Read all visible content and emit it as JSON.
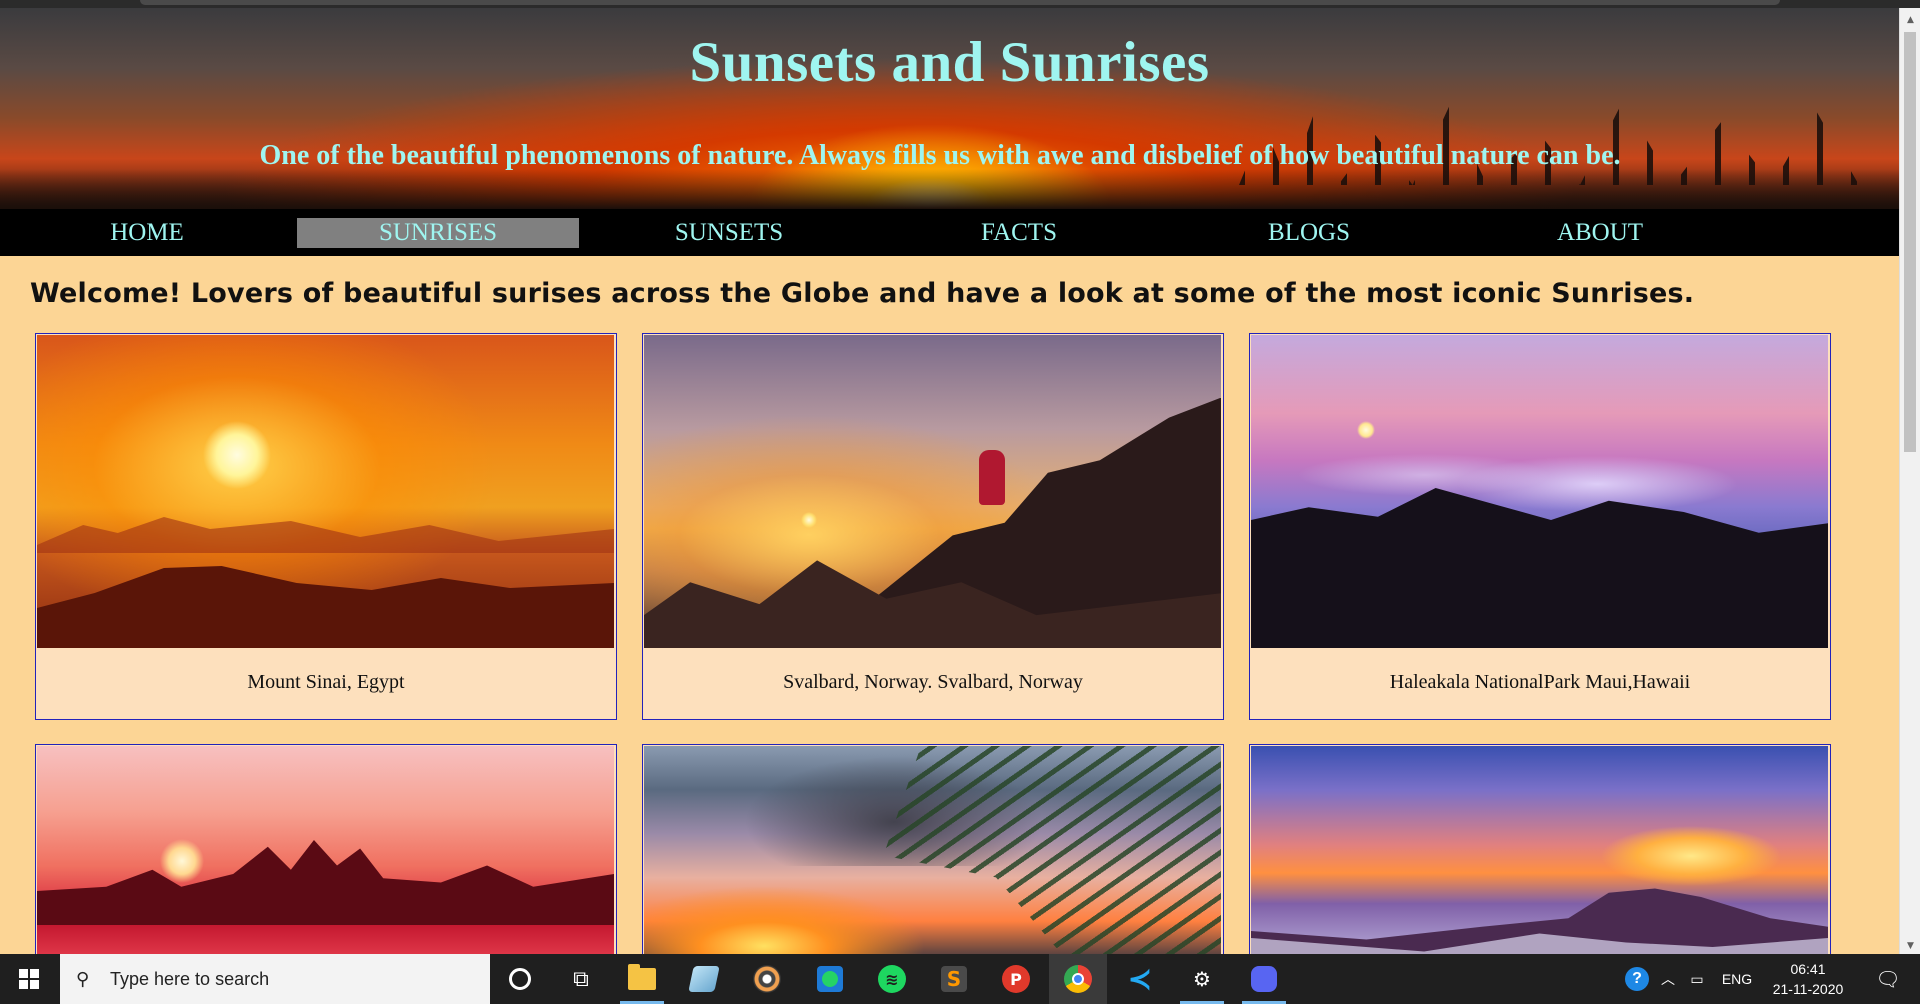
{
  "site": {
    "title": "Sunsets and Sunrises",
    "subtitle": "One of the beautiful phenomenons of nature. Always fills us with awe and disbelief of how beautiful nature can be."
  },
  "nav": {
    "items": [
      {
        "label": "HOME",
        "active": false
      },
      {
        "label": "SUNRISES",
        "active": true
      },
      {
        "label": "SUNSETS",
        "active": false
      },
      {
        "label": "FACTS",
        "active": false
      },
      {
        "label": "BLOGS",
        "active": false
      },
      {
        "label": "ABOUT",
        "active": false
      }
    ]
  },
  "welcome": "Welcome! Lovers of beautiful surises across the Globe and have a look at some of the most iconic Sunrises.",
  "gallery": {
    "cards": [
      {
        "caption": "Mount Sinai, Egypt"
      },
      {
        "caption": "Svalbard, Norway. Svalbard, Norway"
      },
      {
        "caption": "Haleakala NationalPark Maui,Hawaii"
      },
      {
        "caption": ""
      },
      {
        "caption": ""
      },
      {
        "caption": ""
      }
    ]
  },
  "taskbar": {
    "search_placeholder": "Type here to search",
    "language": "ENG",
    "time": "06:41",
    "date": "21-11-2020"
  },
  "colors": {
    "page_bg": "#fcd595",
    "accent_text": "#9ff5f0",
    "nav_bg": "#000000",
    "nav_active_bg": "#808080",
    "card_border": "#2222bb",
    "caption_bg": "#fde0bd"
  }
}
